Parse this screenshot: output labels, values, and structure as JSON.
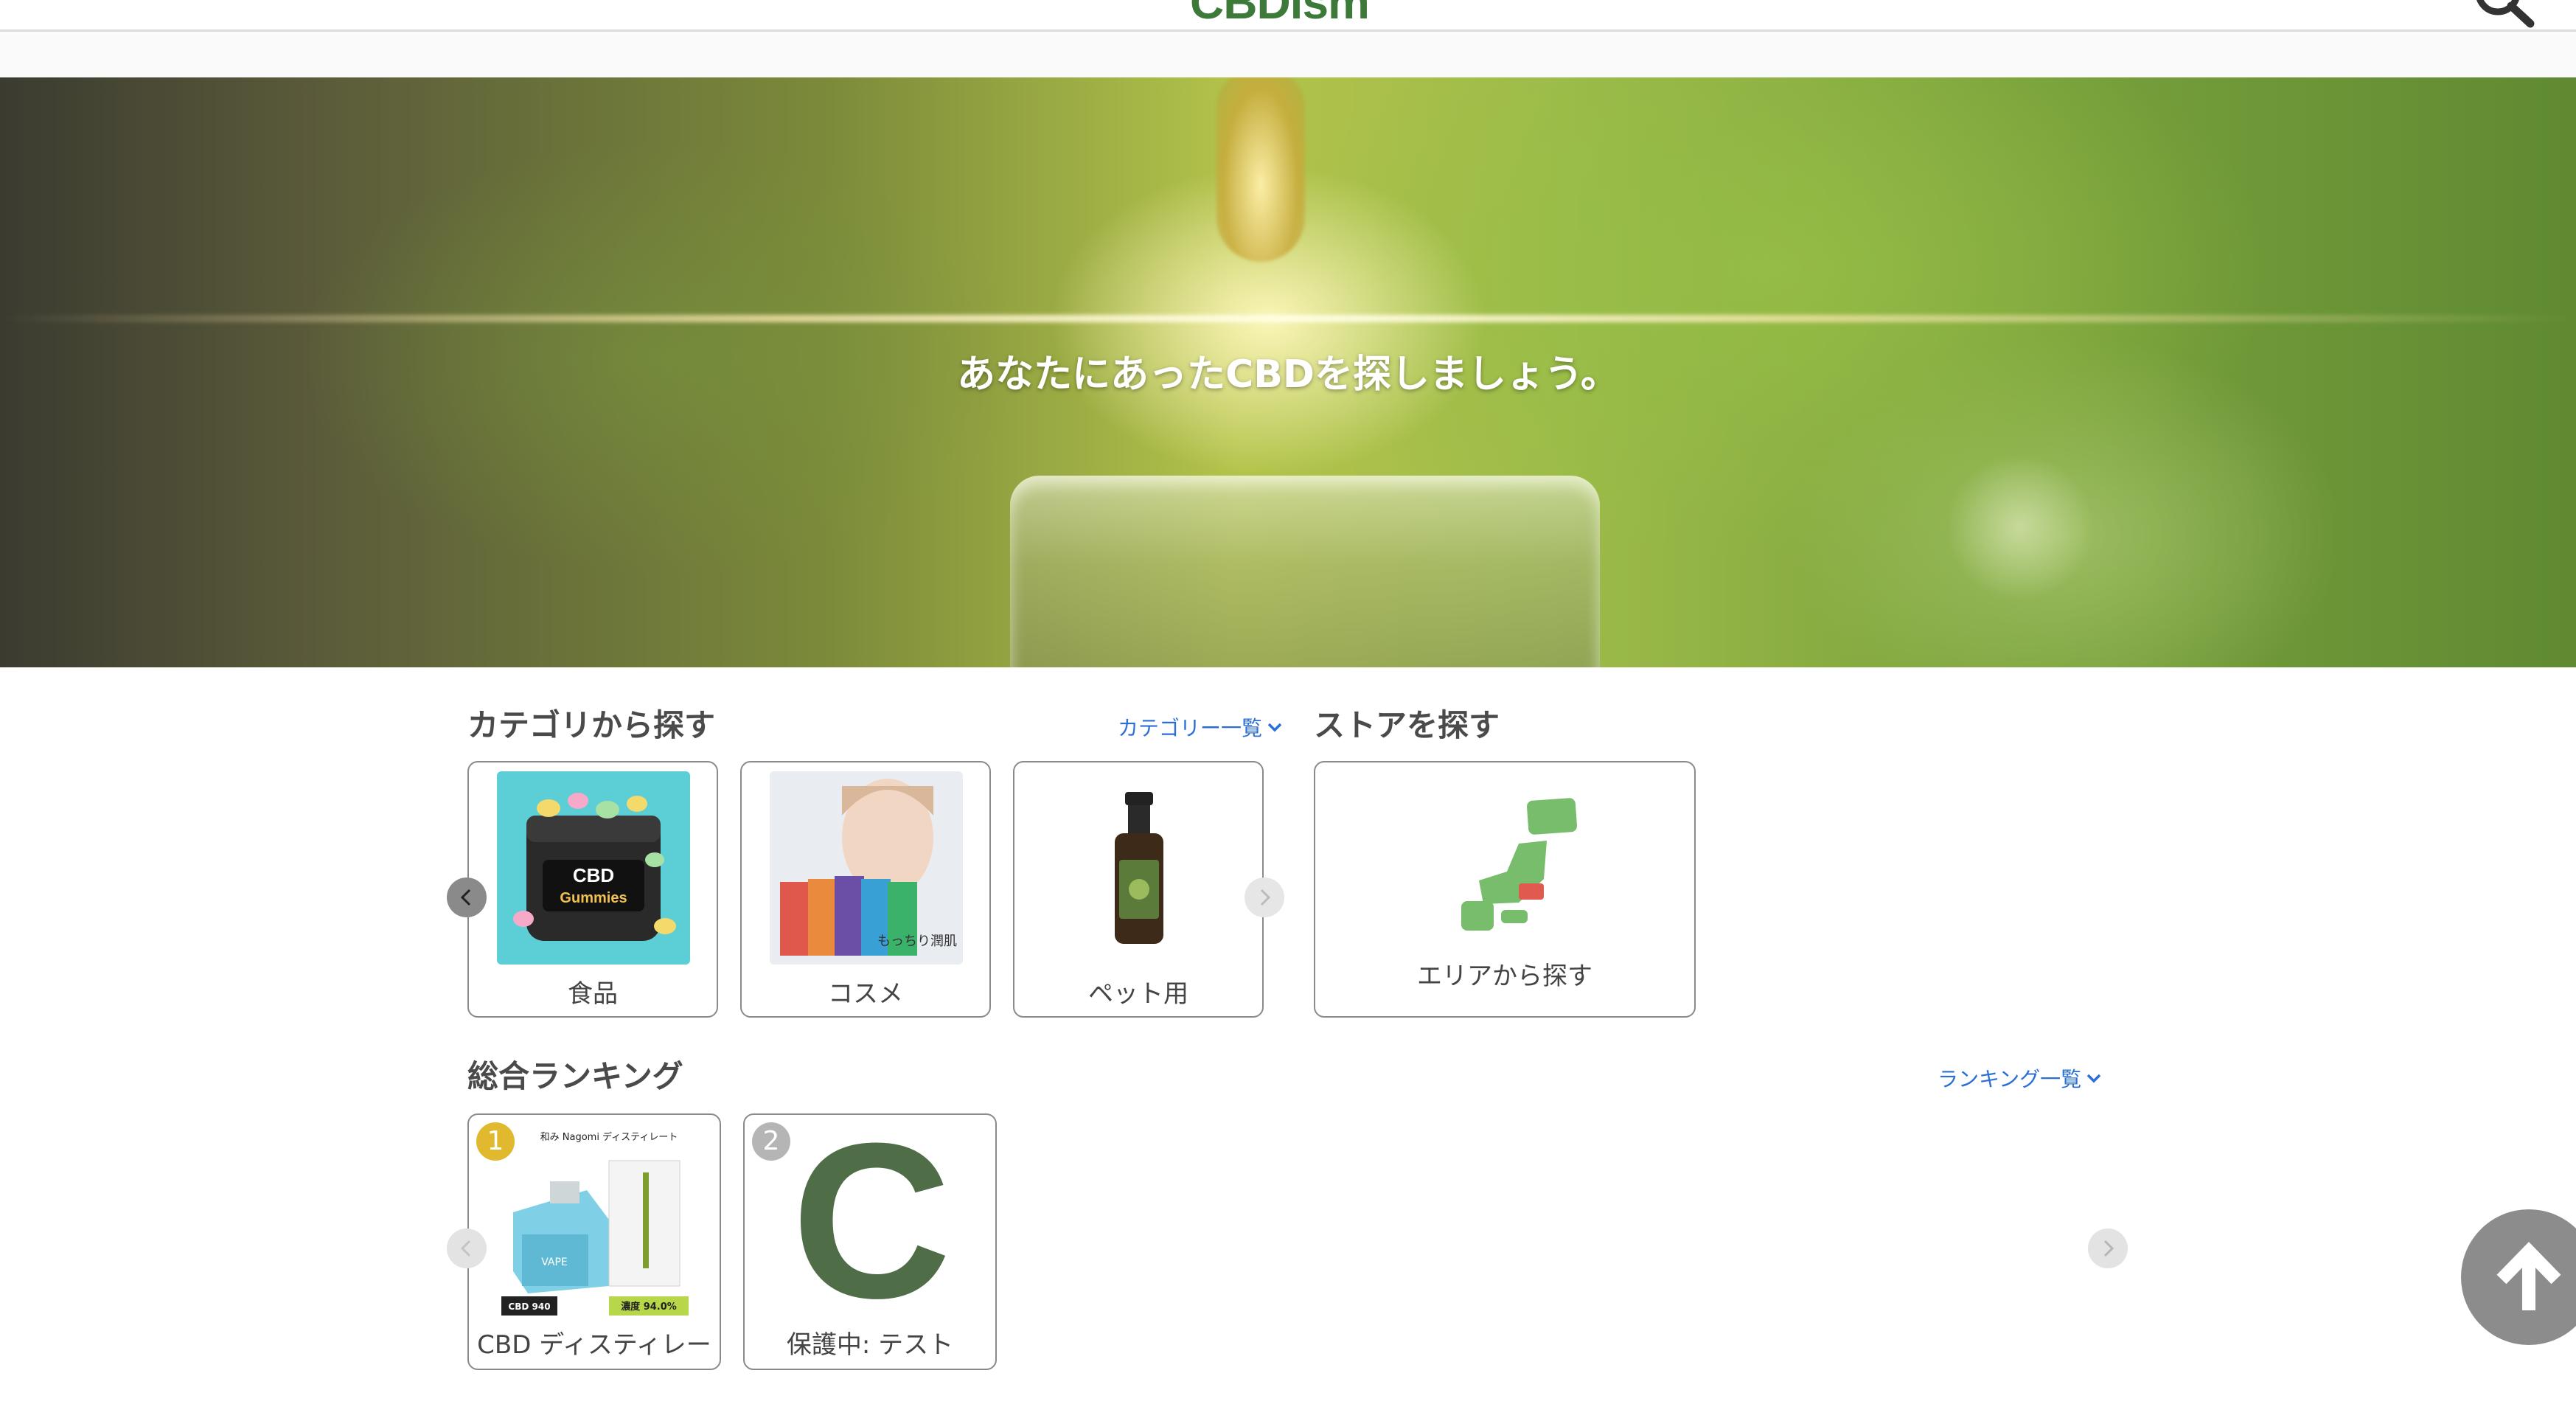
{
  "header": {
    "logo_text": "CBDism",
    "search_icon": "search-icon"
  },
  "hero": {
    "title": "あなたにあったCBDを探しましょう。"
  },
  "category_section": {
    "title": "カテゴリから探す",
    "list_link": "カテゴリー一覧",
    "items": [
      {
        "label": "食品",
        "icon": "gummies-jar-image"
      },
      {
        "label": "コスメ",
        "icon": "face-mask-image"
      },
      {
        "label": "ペット用",
        "icon": "oil-bottle-image"
      }
    ],
    "prev_icon": "chevron-left-icon",
    "next_icon": "chevron-right-icon"
  },
  "store_section": {
    "title": "ストアを探す",
    "area_label": "エリアから探す",
    "map_icon": "japan-map-icon"
  },
  "ranking_section": {
    "title": "総合ランキング",
    "list_link": "ランキング一覧",
    "items": [
      {
        "rank": "1",
        "label": "CBD ディスティレー",
        "image_text": "和み Nagomi ディスティレート",
        "cbd_text": "CBD 940",
        "conc_text": "濃度 94.0%"
      },
      {
        "rank": "2",
        "label": "保護中: テスト",
        "image_text": "C"
      }
    ]
  },
  "colors": {
    "brand_green": "#3d7a3a",
    "link_blue": "#2b6fd6",
    "rank_gold": "#e0b92e",
    "rank_silver": "#b5b5b5",
    "map_green": "#77bd6c",
    "map_red": "#e05a4f",
    "placeholder_green": "#4f6e48"
  }
}
